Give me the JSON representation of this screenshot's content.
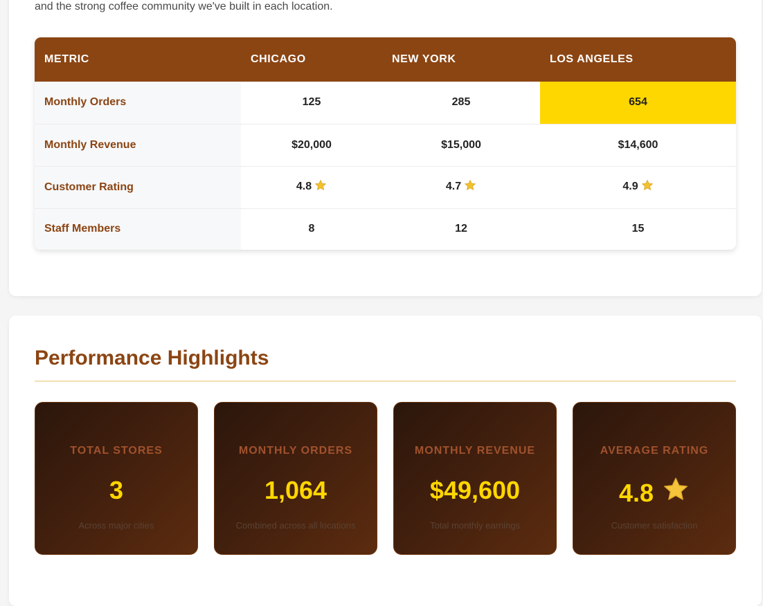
{
  "intro": {
    "text": "and the strong coffee community we've built in each location."
  },
  "table": {
    "headers": [
      "METRIC",
      "CHICAGO",
      "NEW YORK",
      "LOS ANGELES"
    ],
    "rows": [
      {
        "metric": "Monthly Orders",
        "chicago": "125",
        "newyork": "285",
        "losangeles": "654"
      },
      {
        "metric": "Monthly Revenue",
        "chicago": "$20,000",
        "newyork": "$15,000",
        "losangeles": "$14,600"
      },
      {
        "metric": "Customer Rating",
        "chicago": "4.8",
        "newyork": "4.7",
        "losangeles": "4.9"
      },
      {
        "metric": "Staff Members",
        "chicago": "8",
        "newyork": "12",
        "losangeles": "15"
      }
    ],
    "highlight_color": "#ffd700",
    "header_color": "#8b4513",
    "rating_icon": "star-icon"
  },
  "highlights": {
    "title": "Performance Highlights",
    "cards": [
      {
        "label": "TOTAL STORES",
        "value": "3",
        "sub": "Across major cities"
      },
      {
        "label": "MONTHLY ORDERS",
        "value": "1,064",
        "sub": "Combined across all locations"
      },
      {
        "label": "MONTHLY REVENUE",
        "value": "$49,600",
        "sub": "Total monthly earnings"
      },
      {
        "label": "AVERAGE RATING",
        "value": "4.8",
        "sub": "Customer satisfaction",
        "icon": "star-icon"
      }
    ],
    "value_color": "#ffd700",
    "label_color": "#a0522d"
  }
}
